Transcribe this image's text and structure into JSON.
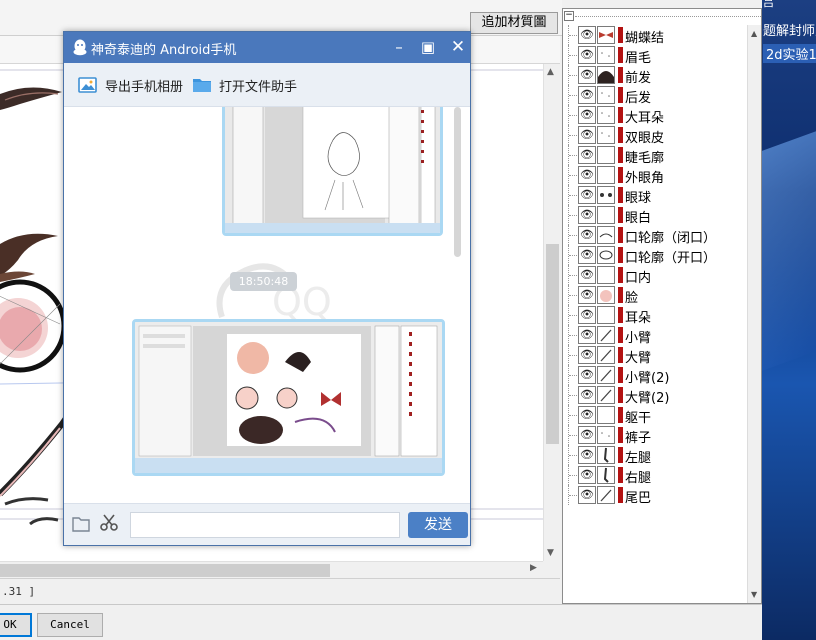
{
  "editor": {
    "add_material_button": "追加材質圖",
    "coord_readout": ".31 ]",
    "ok_label": "OK",
    "cancel_label": "Cancel"
  },
  "layers": [
    {
      "name": "蝴蝶结",
      "thumb": "bow"
    },
    {
      "name": "眉毛",
      "thumb": "dots"
    },
    {
      "name": "前发",
      "thumb": "hair-dark"
    },
    {
      "name": "后发",
      "thumb": "dots"
    },
    {
      "name": "大耳朵",
      "thumb": "dots"
    },
    {
      "name": "双眼皮",
      "thumb": "dots"
    },
    {
      "name": "睫毛廓",
      "thumb": "blank"
    },
    {
      "name": "外眼角",
      "thumb": "blank"
    },
    {
      "name": "眼球",
      "thumb": "eyes"
    },
    {
      "name": "眼白",
      "thumb": "blank"
    },
    {
      "name": "口轮廓（闭口）",
      "thumb": "curve"
    },
    {
      "name": "口轮廓（开口）",
      "thumb": "oval"
    },
    {
      "name": "口内",
      "thumb": "blank"
    },
    {
      "name": "脸",
      "thumb": "face"
    },
    {
      "name": "耳朵",
      "thumb": "blank"
    },
    {
      "name": "小臂",
      "thumb": "line"
    },
    {
      "name": "大臂",
      "thumb": "line"
    },
    {
      "name": "小臂(2)",
      "thumb": "line"
    },
    {
      "name": "大臂(2)",
      "thumb": "line"
    },
    {
      "name": "躯干",
      "thumb": "blank"
    },
    {
      "name": "裤子",
      "thumb": "dots"
    },
    {
      "name": "左腿",
      "thumb": "leg"
    },
    {
      "name": "右腿",
      "thumb": "leg"
    },
    {
      "name": "尾巴",
      "thumb": "line"
    }
  ],
  "desktop": {
    "line1": "吕",
    "line2": "题解封师人",
    "line3": "2d实验1"
  },
  "qq_window": {
    "title": "神奇泰迪的 Android手机",
    "minimize_icon": "minimize-icon",
    "maximize_icon": "maximize-icon",
    "close_icon": "close-icon",
    "export_photos_label": "导出手机相册",
    "open_file_helper_label": "打开文件助手",
    "timestamp": "18:50:48",
    "send_label": "发送",
    "input_value": ""
  }
}
